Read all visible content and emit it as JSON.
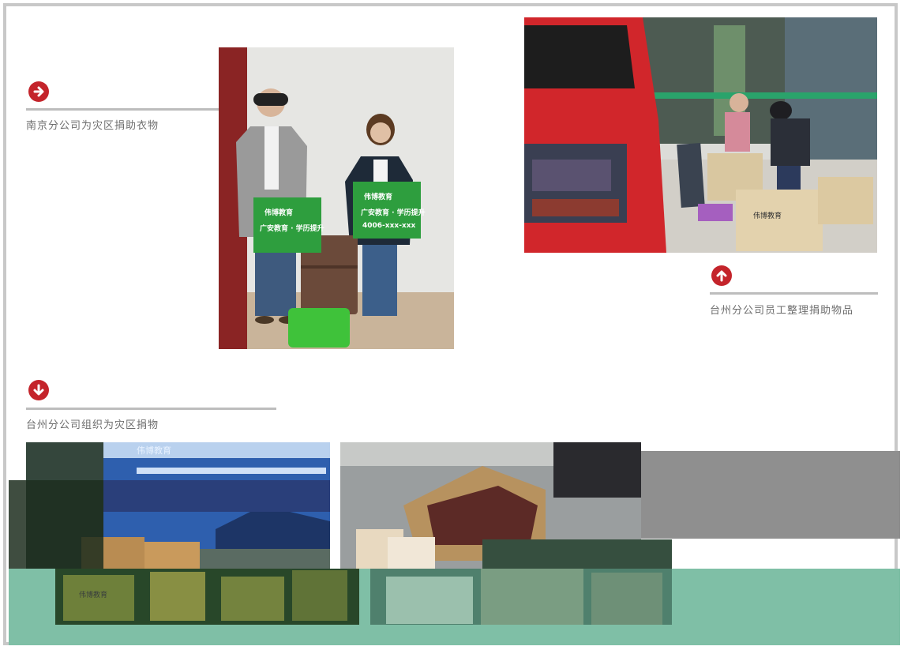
{
  "captions": {
    "nanjing": "南京分公司为灾区捐助衣物",
    "taizhou_staff": "台州分公司员工整理捐助物品",
    "taizhou_org": "台州分公司组织为灾区捐物"
  },
  "photos": {
    "people_bags": {
      "bag_text": "伟博教育",
      "bag_sub": "广安教育 · 学历提升",
      "bag_phone": "4006-xxx-xxx"
    },
    "car_loading": {
      "box_text": "伟博教育"
    },
    "banner_room": {
      "banner_title": "伟博教育",
      "box_text": "伟博教育"
    },
    "floor_boxes": {}
  },
  "icons": {
    "nanjing_arrow": "arrow-right-icon",
    "taizhou_staff_arrow": "arrow-up-icon",
    "taizhou_org_arrow": "arrow-down-icon"
  },
  "colors": {
    "accent": "#c4242b",
    "rule": "#bdbdbd",
    "caption": "#6d6d6d",
    "overlay_teal": "#7fbfa6",
    "overlay_gray": "#8f8f8f"
  }
}
